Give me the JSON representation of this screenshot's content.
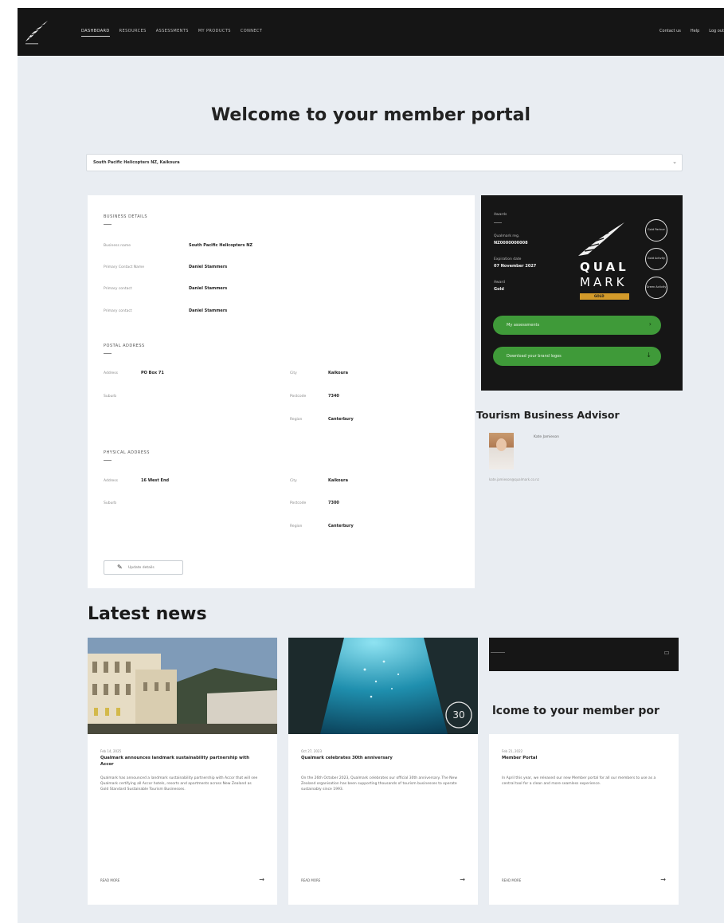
{
  "nav": {
    "links": [
      "Dashboard",
      "Resources",
      "Assessments",
      "My Products",
      "Connect"
    ],
    "right_links": [
      "Contact us",
      "Help",
      "Log out"
    ]
  },
  "welcome": "Welcome to your member portal",
  "business_selector": {
    "value": "South Pacific Helicopters NZ, Kaikoura"
  },
  "details": {
    "business_title": "Business details",
    "rows": [
      {
        "label": "Business name",
        "value": "South Pacific Helicopters NZ"
      },
      {
        "label": "Primary Contact Name",
        "value": "Daniel Stammers"
      },
      {
        "label": "Primary contact",
        "value": "Daniel Stammers"
      },
      {
        "label": "Primary contact",
        "value": "Daniel Stammers"
      }
    ],
    "postal_title": "Postal address",
    "postal": {
      "address": {
        "label": "Address",
        "value": "PO Box 71"
      },
      "suburb": {
        "label": "Suburb",
        "value": ""
      },
      "city": {
        "label": "City",
        "value": "Kaikoura"
      },
      "postcode": {
        "label": "Postcode",
        "value": "7340"
      },
      "region": {
        "label": "Region",
        "value": "Canterbury"
      }
    },
    "physical_title": "Physical address",
    "physical": {
      "address": {
        "label": "Address",
        "value": "16 West End"
      },
      "suburb": {
        "label": "Suburb",
        "value": ""
      },
      "city": {
        "label": "City",
        "value": "Kaikoura"
      },
      "postcode": {
        "label": "Postcode",
        "value": "7300"
      },
      "region": {
        "label": "Region",
        "value": "Canterbury"
      }
    },
    "update_button": "Update details"
  },
  "qualmark": {
    "heading": "Awards",
    "number_label": "Qualmark reg.",
    "number": "NZ0000000008",
    "expiry_label": "Expiration date",
    "expiry": "07 November 2027",
    "award_label": "Award",
    "award": "Gold",
    "logo_top": "QUAL",
    "logo_bottom": "MARK",
    "logo_tier": "GOLD",
    "badges": [
      "Gold Partner",
      "Gold Activity",
      "Green Activity"
    ],
    "buttons": [
      "My assessments",
      "Download your brand logos"
    ],
    "green": "#3f9a39",
    "gold": "#d39a2a"
  },
  "advisor": {
    "title": "Tourism Business Advisor",
    "name": "Kate Jamieson",
    "email": "kate.jamieson@qualmark.co.nz"
  },
  "news": {
    "heading": "Latest news",
    "items": [
      {
        "date": "Feb 14, 2025",
        "title": "Qualmark announces landmark sustainability partnership with Accor",
        "body": "Qualmark has announced a landmark sustainability partnership with Accor that will see Qualmark certifying all Accor hotels, resorts and apartments across New Zealand as Gold Standard Sustainable Tourism Businesses.",
        "read_more": "Read more"
      },
      {
        "date": "Oct 27, 2023",
        "title": "Qualmark celebrates 30th anniversary",
        "body": "On the 26th October 2023, Qualmark celebrates our official 30th anniversary. The New Zealand organisation has been supporting thousands of tourism businesses to operate sustainably since 1993.",
        "read_more": "Read more"
      },
      {
        "date": "Feb 21, 2022",
        "title": "Member Portal",
        "body": "In April this year, we released our new Member portal for all our members to use as a central tool for a clean and more seamless experience.",
        "read_more": "Read more",
        "preview_heading": "lcome to your member por"
      }
    ]
  }
}
